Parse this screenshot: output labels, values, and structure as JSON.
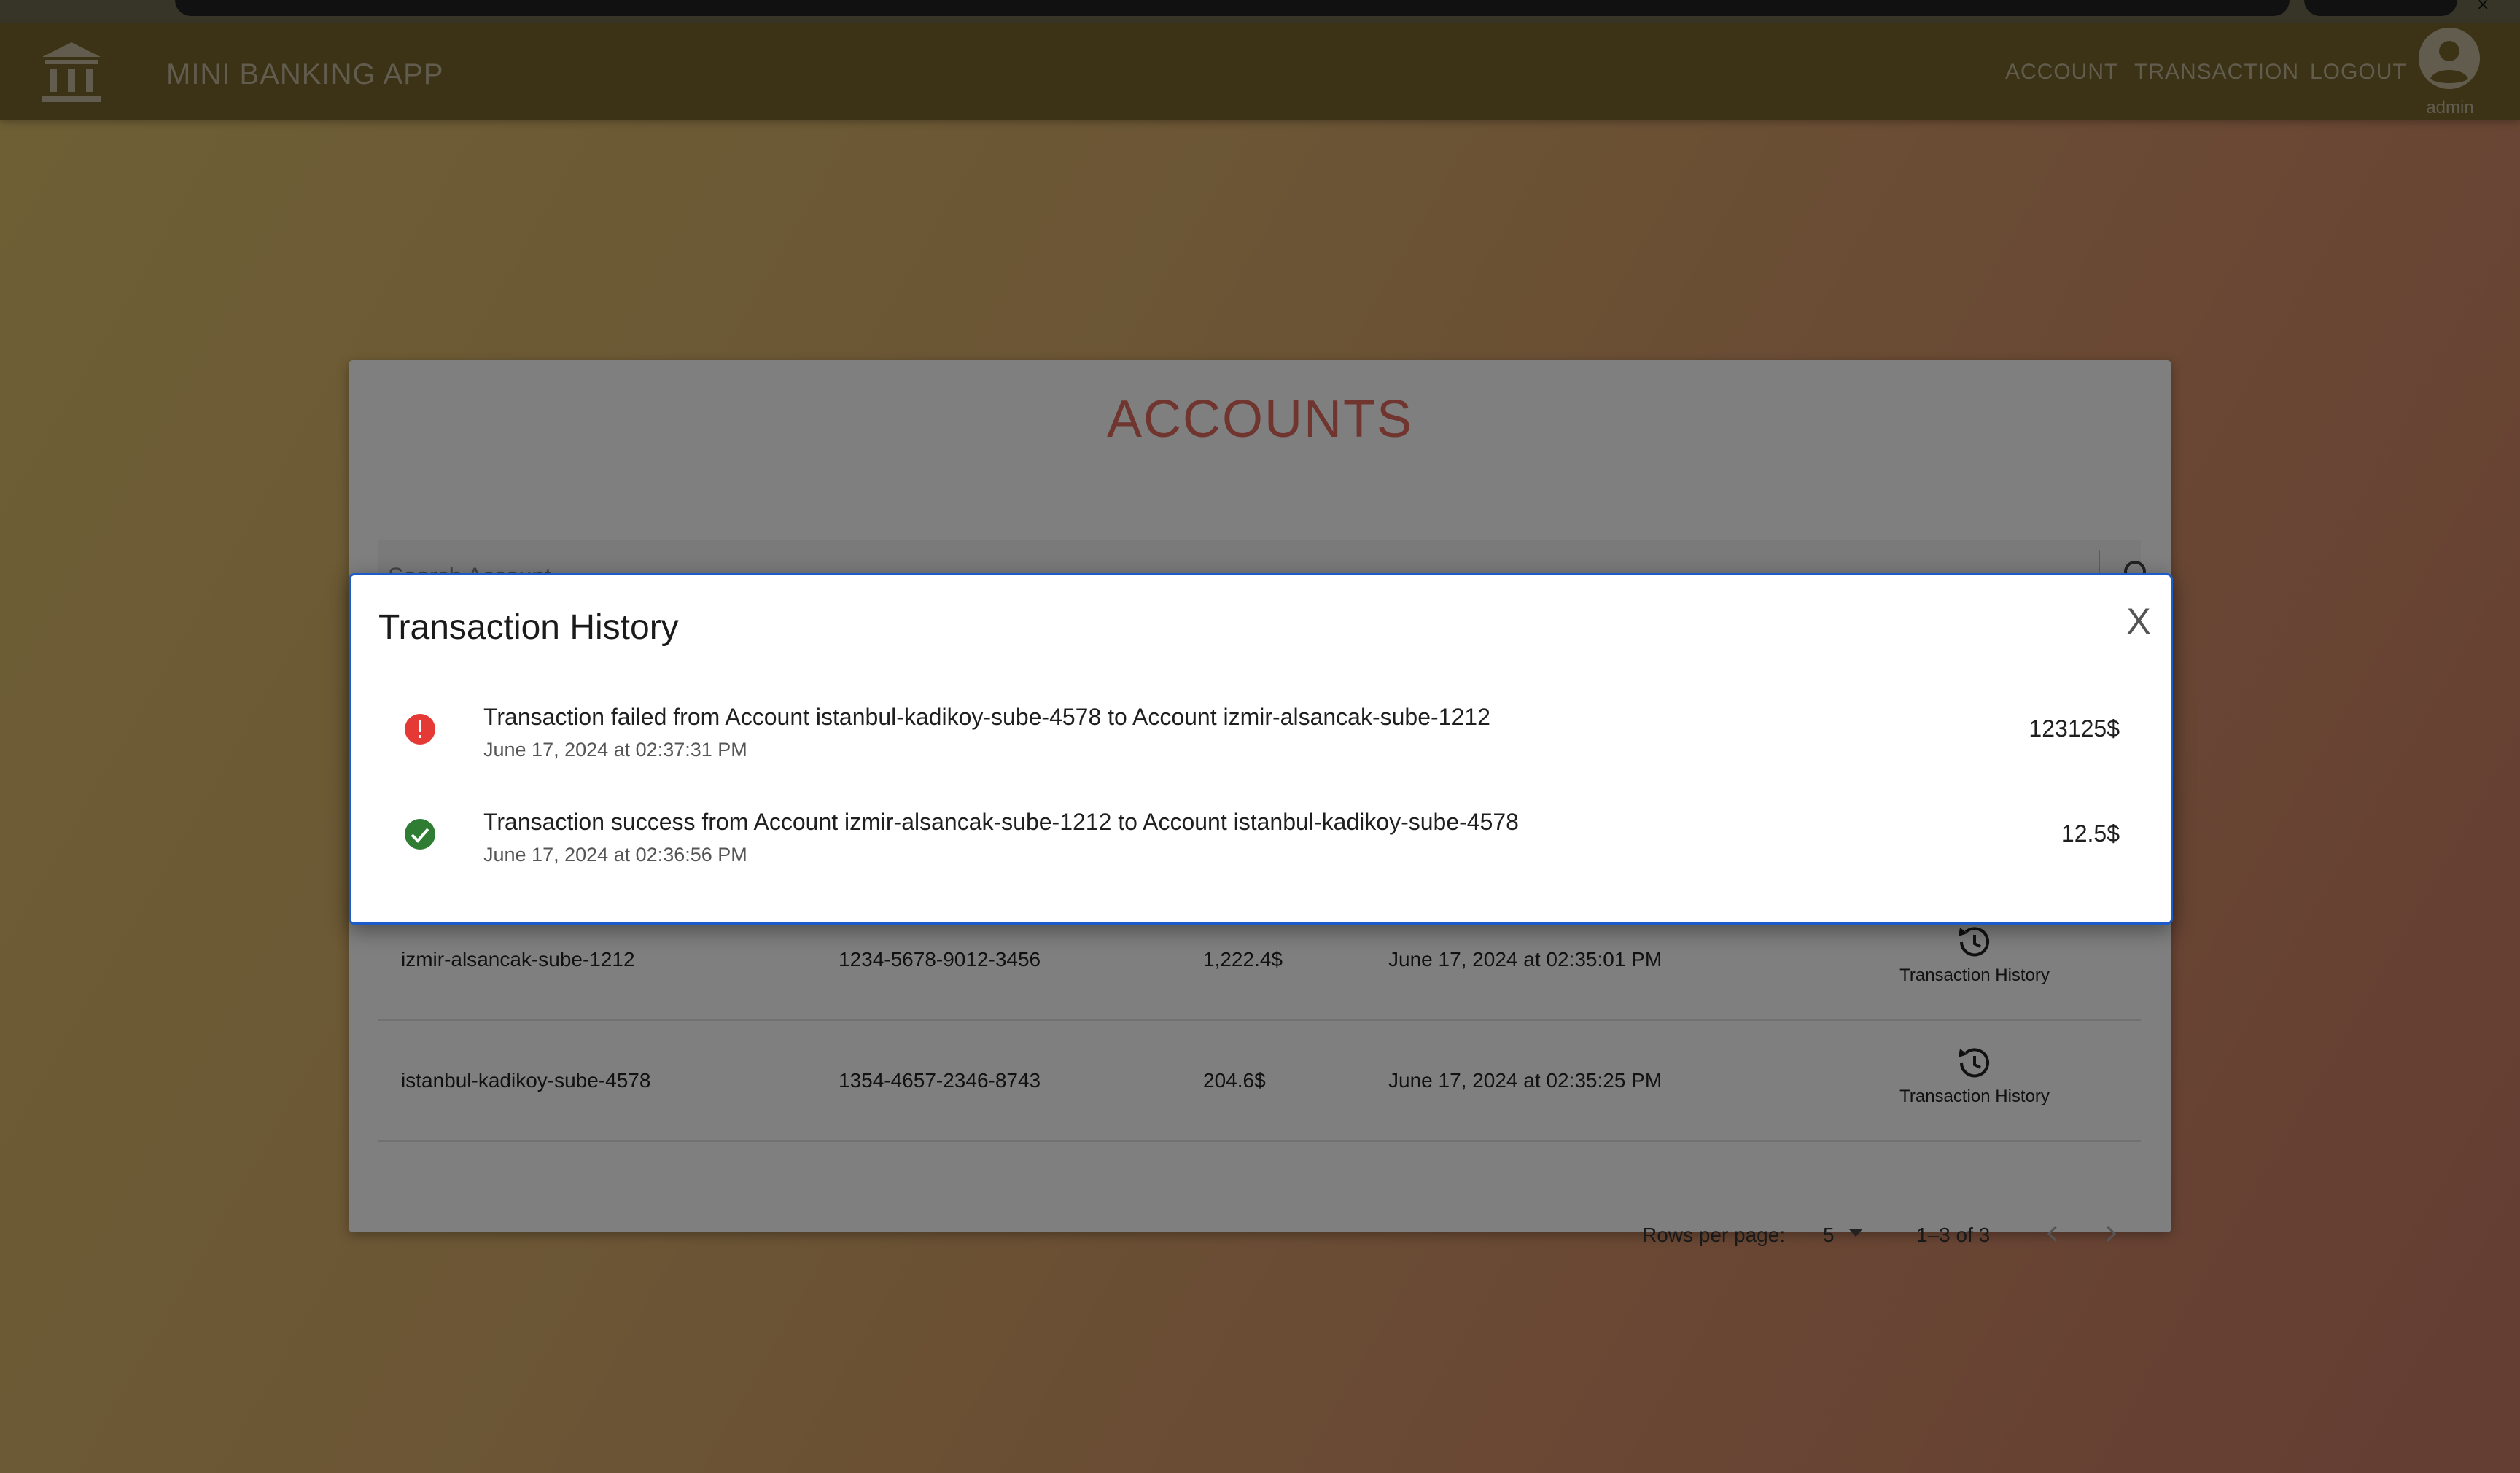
{
  "app": {
    "title": "MINI BANKING APP",
    "nav": {
      "account": "ACCOUNT",
      "transaction": "TRANSACTION",
      "logout": "LOGOUT"
    },
    "user": "admin"
  },
  "accounts": {
    "title": "ACCOUNTS",
    "search_placeholder": "Search Account",
    "rows": [
      {
        "name": "izmir-alsancak-sube-1212",
        "number": "1234-5678-9012-3456",
        "balance": "1,222.4$",
        "date": "June 17, 2024 at 02:35:01 PM",
        "action": "Transaction History"
      },
      {
        "name": "istanbul-kadikoy-sube-4578",
        "number": "1354-4657-2346-8743",
        "balance": "204.6$",
        "date": "June 17, 2024 at 02:35:25 PM",
        "action": "Transaction History"
      }
    ],
    "pagination": {
      "rows_per_page_label": "Rows per page:",
      "rows_per_page": "5",
      "range": "1–3 of 3"
    }
  },
  "modal": {
    "title": "Transaction History",
    "close_label": "X",
    "transactions": [
      {
        "status": "failed",
        "text": "Transaction failed from Account istanbul-kadikoy-sube-4578 to Account izmir-alsancak-sube-1212",
        "date": "June 17, 2024 at 02:37:31 PM",
        "amount": "123125$"
      },
      {
        "status": "success",
        "text": "Transaction success from Account izmir-alsancak-sube-1212 to Account istanbul-kadikoy-sube-4578",
        "date": "June 17, 2024 at 02:36:56 PM",
        "amount": "12.5$"
      }
    ]
  },
  "colors": {
    "accent_title": "#e06a5d",
    "modal_border": "#1c5cc9",
    "failed": "#e53935",
    "success": "#2e7d32"
  },
  "icons": {
    "logo": "bank-icon",
    "avatar": "account-circle-icon",
    "search": "search-icon",
    "history": "history-icon",
    "failed": "error-icon",
    "success": "check-circle-icon"
  }
}
